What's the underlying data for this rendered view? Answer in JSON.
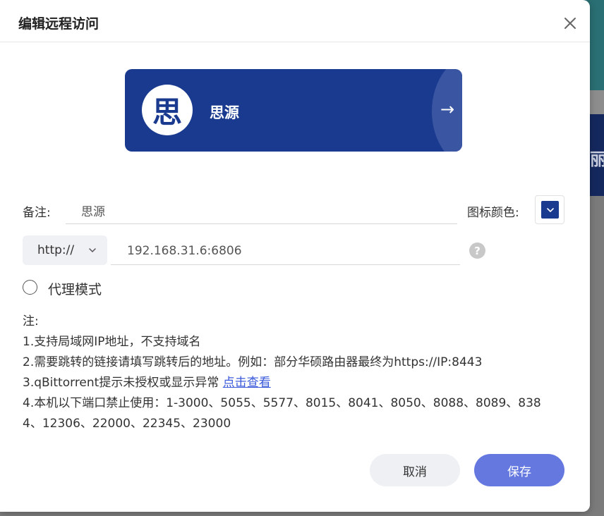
{
  "background": {
    "fragment_text": "丽"
  },
  "dialog": {
    "title": "编辑远程访问",
    "close_icon": "close-icon"
  },
  "preview": {
    "icon_char": "思",
    "name": "思源",
    "arrow": "→",
    "card_color": "#1a3a8f"
  },
  "form": {
    "remark_label": "备注:",
    "remark_value": "思源",
    "icon_color_label": "图标颜色:",
    "icon_color": "#1a3a8f",
    "protocol": "http://",
    "address_value": "192.168.31.6:6806",
    "help_icon": "?",
    "proxy_mode_label": "代理模式",
    "proxy_mode_checked": false
  },
  "notes": {
    "heading": "注:",
    "line1": "1.支持局域网IP地址，不支持域名",
    "line2": "2.需要跳转的链接请填写跳转后的地址。例如：部分华硕路由器最终为https://IP:8443",
    "line3_text": "3.qBittorrent提示未授权或显示异常 ",
    "line3_link": "点击查看",
    "line4a": "4.本机以下端口禁止使用：1-3000、5055、5577、8015、8041、8050、8088、8089、838",
    "line4b": "4、12306、22000、22345、23000"
  },
  "buttons": {
    "cancel": "取消",
    "save": "保存"
  },
  "colors": {
    "save_button": "#6478e0",
    "link": "#3b5bdb"
  }
}
